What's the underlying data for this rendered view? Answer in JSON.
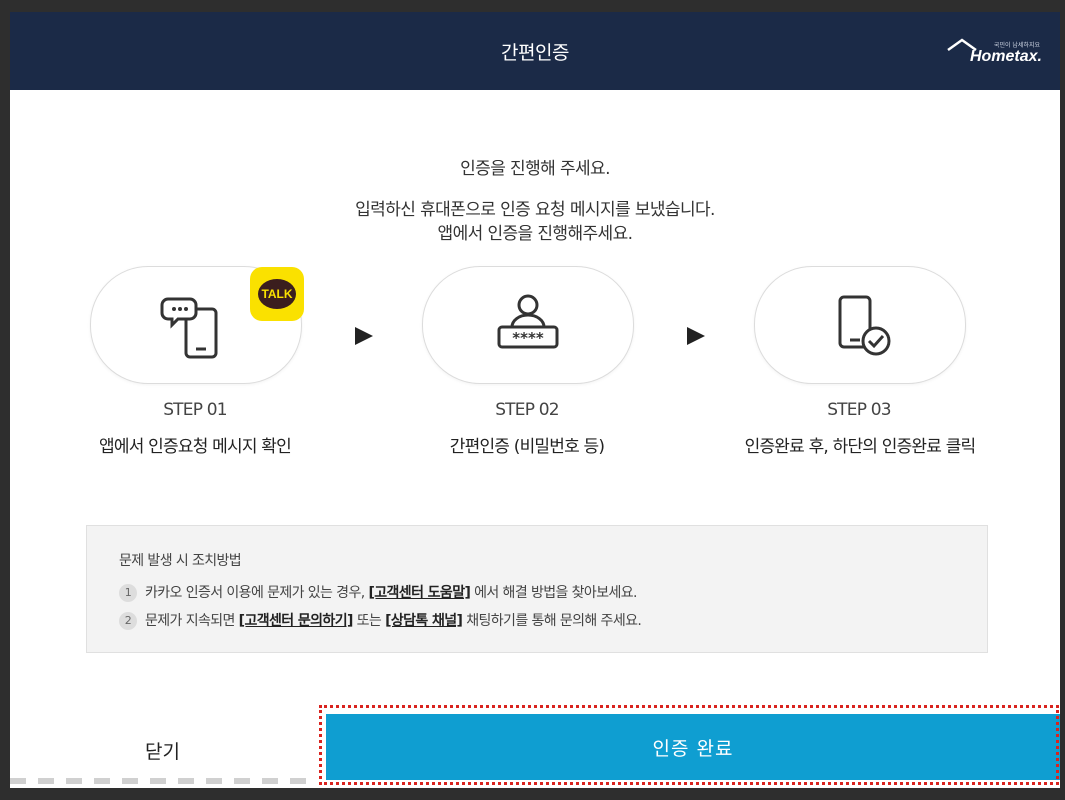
{
  "header": {
    "title": "간편인증",
    "logo_text": "Hometax.",
    "logo_tagline": "국민이 납세하지요"
  },
  "intro": {
    "line1": "인증을 진행해 주세요.",
    "line2": "입력하신 휴대폰으로 인증 요청 메시지를 보냈습니다.",
    "line3": "앱에서 인증을 진행해주세요."
  },
  "steps": [
    {
      "label": "STEP 01",
      "desc": "앱에서 인증요청 메시지 확인",
      "icon": "phone-chat-icon",
      "badge": "TALK"
    },
    {
      "label": "STEP 02",
      "desc": "간편인증 (비밀번호 등)",
      "icon": "user-password-icon",
      "password_mask": "****"
    },
    {
      "label": "STEP 03",
      "desc": "인증완료 후, 하단의 인증완료 클릭",
      "icon": "phone-check-icon"
    }
  ],
  "help": {
    "title": "문제 발생 시 조치방법",
    "items": [
      {
        "num": "1",
        "pre": "카카오 인증서 이용에 문제가 있는 경우, ",
        "link1": "[고객센터 도움말]",
        "mid": " 에서 해결 방법을 찾아보세요.",
        "link2": "",
        "post": ""
      },
      {
        "num": "2",
        "pre": "문제가 지속되면 ",
        "link1": "[고객센터 문의하기]",
        "mid": " 또는 ",
        "link2": "[상담톡 채널]",
        "post": " 채팅하기를 통해 문의해 주세요."
      }
    ]
  },
  "footer": {
    "close_label": "닫기",
    "complete_label": "인증 완료"
  },
  "colors": {
    "header_bg": "#1b2a47",
    "primary": "#0f9ed1",
    "kakao_yellow": "#fae100",
    "highlight": "#d9231e"
  }
}
